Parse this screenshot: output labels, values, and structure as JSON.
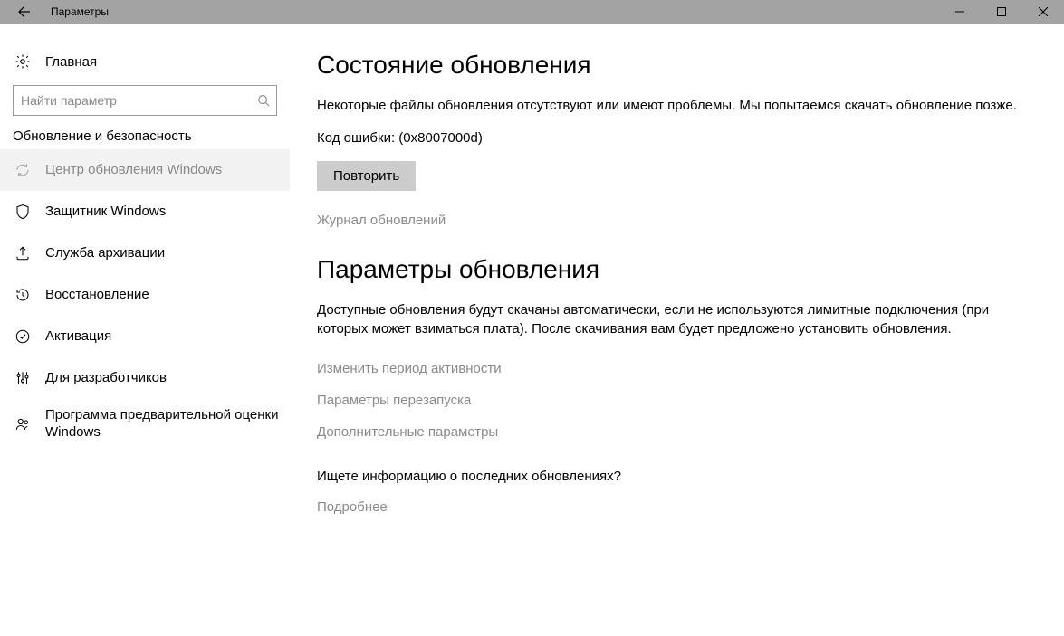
{
  "titlebar": {
    "title": "Параметры"
  },
  "sidebar": {
    "home": "Главная",
    "search_placeholder": "Найти параметр",
    "section": "Обновление и безопасность",
    "items": [
      {
        "label": "Центр обновления Windows"
      },
      {
        "label": "Защитник Windows"
      },
      {
        "label": "Служба архивации"
      },
      {
        "label": "Восстановление"
      },
      {
        "label": "Активация"
      },
      {
        "label": "Для разработчиков"
      },
      {
        "label": "Программа предварительной оценки Windows"
      }
    ]
  },
  "content": {
    "status_heading": "Состояние обновления",
    "status_text": "Некоторые файлы обновления отсутствуют или имеют проблемы. Мы попытаемся скачать обновление позже.",
    "error_code": "Код ошибки: (0x8007000d)",
    "retry_button": "Повторить",
    "history_link": "Журнал обновлений",
    "params_heading": "Параметры обновления",
    "params_text": "Доступные обновления будут скачаны автоматически, если не используются лимитные подключения (при которых может взиматься плата). После скачивания вам будет предложено установить обновления.",
    "link_active_hours": "Изменить период активности",
    "link_restart": "Параметры перезапуска",
    "link_advanced": "Дополнительные параметры",
    "info_prompt": "Ищете информацию о последних обновлениях?",
    "more_link": "Подробнее"
  }
}
